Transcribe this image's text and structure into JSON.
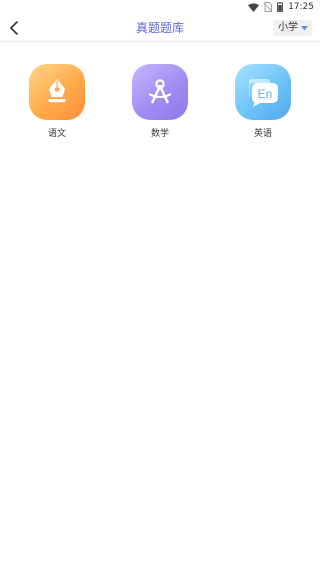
{
  "status_bar": {
    "time": "17:25"
  },
  "header": {
    "title": "真题题库",
    "grade_selected": "小学"
  },
  "subjects": [
    {
      "label": "语文",
      "icon": "fountain-pen-icon"
    },
    {
      "label": "数学",
      "icon": "compass-icon"
    },
    {
      "label": "英语",
      "icon": "english-speech-bubble-icon",
      "icon_text": "En"
    }
  ],
  "colors": {
    "title": "#5b66d8",
    "chinese_icon": "#ffaa4a",
    "math_icon": "#a28cf2",
    "english_icon": "#6dc3f7"
  }
}
